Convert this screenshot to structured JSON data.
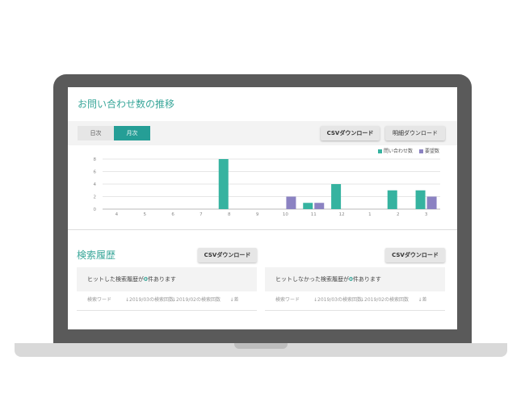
{
  "inquiry": {
    "title": "お問い合わせ数の推移",
    "tabs": [
      {
        "label": "日次",
        "active": false
      },
      {
        "label": "月次",
        "active": true
      }
    ],
    "csv_button": "CSVダウンロード",
    "detail_button": "明細ダウンロード"
  },
  "chart_data": {
    "type": "bar",
    "categories": [
      "4",
      "5",
      "6",
      "7",
      "8",
      "9",
      "10",
      "11",
      "12",
      "1",
      "2",
      "3"
    ],
    "series": [
      {
        "name": "問い合わせ数",
        "color": "#36b3a0",
        "values": [
          0,
          0,
          0,
          0,
          8,
          0,
          0,
          1,
          4,
          0,
          3,
          3
        ]
      },
      {
        "name": "要望数",
        "color": "#8b82c2",
        "values": [
          0,
          0,
          0,
          0,
          0,
          0,
          2,
          1,
          0,
          0,
          0,
          2
        ]
      }
    ],
    "yticks": [
      0,
      2,
      4,
      6,
      8
    ],
    "ylim": [
      0,
      8
    ],
    "grid": true,
    "legend": "top-right"
  },
  "search": {
    "title": "検索履歴",
    "csv_button": "CSVダウンロード",
    "hit": {
      "prefix": "ヒットした検索履歴が",
      "count": "0",
      "suffix": " 件あります"
    },
    "nohit": {
      "prefix": "ヒットしなかった検索履歴が",
      "count": "0",
      "suffix": " 件あります"
    },
    "columns": [
      "検索ワード",
      "↓2019/03の検索回数",
      "↓2019/02の検索回数",
      "↓差"
    ]
  }
}
